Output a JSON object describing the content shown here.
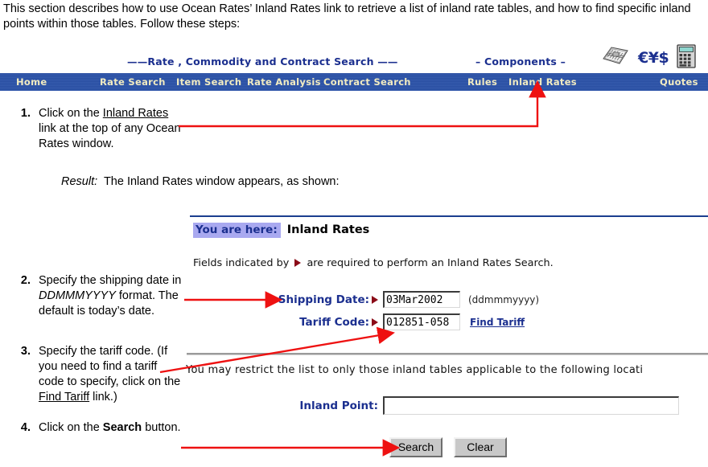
{
  "intro": {
    "text": "This section describes how to use Ocean Rates’ Inland Rates link to retrieve a list of inland rate tables, and how to find specific inland points within those tables. Follow these steps:"
  },
  "app": {
    "captions": {
      "rate_search": "——Rate , Commodity and Contract  Search ——",
      "components": "–  Components –"
    },
    "header_icons": {
      "device": "device-icon",
      "currency": "€¥$",
      "calculator": "calculator-icon"
    },
    "nav": {
      "items": [
        {
          "label": "Home"
        },
        {
          "label": "Rate Search"
        },
        {
          "label": "Item Search"
        },
        {
          "label": "Rate Analysis"
        },
        {
          "label": "Contract Search"
        },
        {
          "label": "Rules"
        },
        {
          "label": "Inland Rates"
        },
        {
          "label": "Quotes"
        }
      ],
      "bg_color": "#2b52a8",
      "text_color": "#f2ecc2"
    },
    "breadcrumb": {
      "here_label": "You are here:",
      "page": "Inland Rates",
      "badge_color": "#a9a9f0",
      "accent_color": "#1b2f8f"
    },
    "required_note": {
      "before": "Fields indicated by",
      "after": "are required to perform an Inland Rates Search.",
      "marker_color": "#8b0c18"
    },
    "fields": {
      "shipping_date": {
        "label": "Shipping Date:",
        "value": "03Mar2002",
        "placeholder": "",
        "hint": "(ddmmmyyyy)",
        "required": true
      },
      "tariff_code": {
        "label": "Tariff Code:",
        "value": "012851-058",
        "placeholder": "",
        "link": "Find Tariff",
        "required": true
      },
      "inland_point": {
        "label": "Inland Point:",
        "value": "",
        "placeholder": "",
        "required": false
      }
    },
    "restrict_text": "You may restrict the list to only those inland tables applicable to the following locati",
    "buttons": {
      "search": "Search",
      "clear": "Clear"
    }
  },
  "steps": [
    {
      "num": "1.",
      "parts": [
        {
          "t": "Click on the ",
          "style": "plain"
        },
        {
          "t": "Inland Rates",
          "style": "underline"
        },
        {
          "t": " link at the top of any Ocean Rates window.",
          "style": "plain"
        }
      ]
    },
    {
      "num": "2.",
      "parts": [
        {
          "t": "Specify the shipping date in ",
          "style": "plain"
        },
        {
          "t": "DDMMMYYYY",
          "style": "italic"
        },
        {
          "t": " format. The default is today’s date.",
          "style": "plain"
        }
      ]
    },
    {
      "num": "3.",
      "parts": [
        {
          "t": "Specify the tariff code. (If you need to find a tariff code to specify, click on the ",
          "style": "plain"
        },
        {
          "t": "Find Tariff",
          "style": "underline"
        },
        {
          "t": " link.)",
          "style": "plain"
        }
      ]
    },
    {
      "num": "4.",
      "parts": [
        {
          "t": "Click on the ",
          "style": "plain"
        },
        {
          "t": "Search",
          "style": "bold"
        },
        {
          "t": " button.",
          "style": "plain"
        }
      ]
    }
  ],
  "result_note": {
    "label": "Result:",
    "text": "The Inland Rates window appears, as shown:"
  },
  "annotations": {
    "arrow_color": "#ee1111"
  }
}
